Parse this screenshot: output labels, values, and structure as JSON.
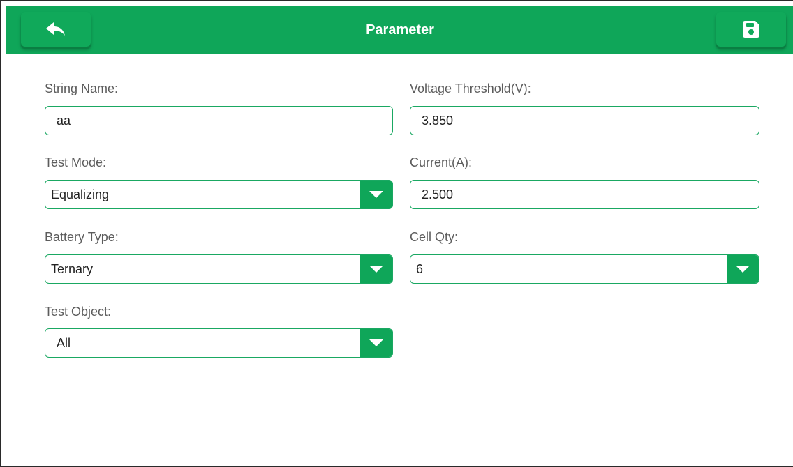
{
  "header": {
    "title": "Parameter",
    "back_icon": "back-arrow-icon",
    "save_icon": "save-floppy-icon",
    "color": "#0fa659"
  },
  "form": {
    "string_name": {
      "label": "String Name:",
      "value": "aa"
    },
    "voltage_threshold": {
      "label": "Voltage Threshold(V):",
      "value": "3.850"
    },
    "test_mode": {
      "label": "Test Mode:",
      "value": "Equalizing"
    },
    "current": {
      "label": "Current(A):",
      "value": "2.500"
    },
    "battery_type": {
      "label": "Battery Type:",
      "value": "Ternary"
    },
    "cell_qty": {
      "label": "Cell Qty:",
      "value": "6"
    },
    "test_object": {
      "label": "Test Object:",
      "value": "All"
    }
  },
  "dropdown_icon": "chevron-down-icon"
}
